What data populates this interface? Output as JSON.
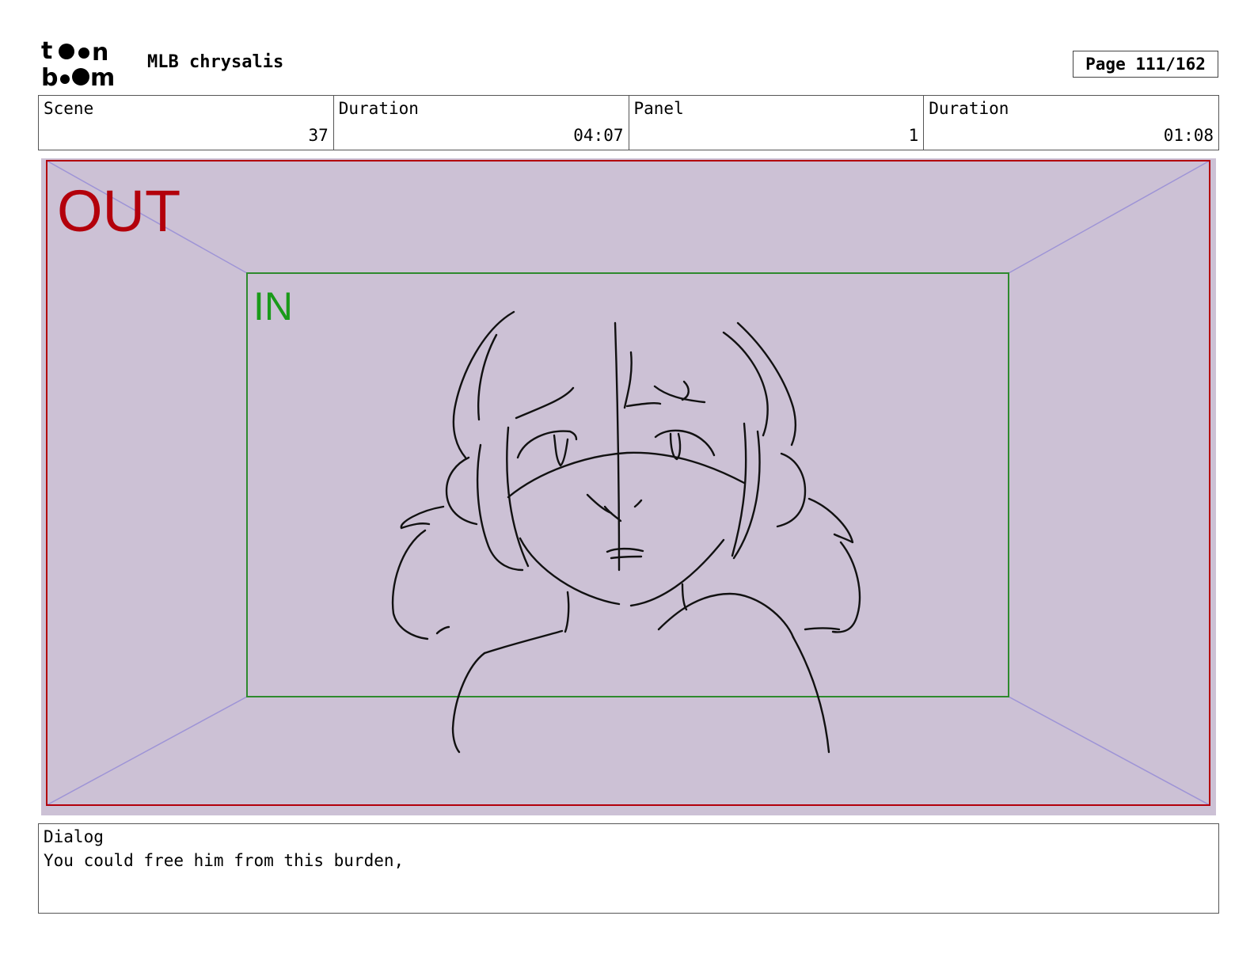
{
  "header": {
    "logo_text": "toon boom",
    "project_title": "MLB chrysalis",
    "page_label": "Page 111/162"
  },
  "info": {
    "scene_label": "Scene",
    "scene_value": "37",
    "scene_duration_label": "Duration",
    "scene_duration_value": "04:07",
    "panel_label": "Panel",
    "panel_value": "1",
    "panel_duration_label": "Duration",
    "panel_duration_value": "01:08"
  },
  "frame": {
    "out_label": "OUT",
    "in_label": "IN",
    "background_color": "#ccc1d5",
    "out_color": "#b3000b",
    "in_color": "#1a9a1a"
  },
  "dialog": {
    "label": "Dialog",
    "text": "You could free him from this burden,"
  }
}
